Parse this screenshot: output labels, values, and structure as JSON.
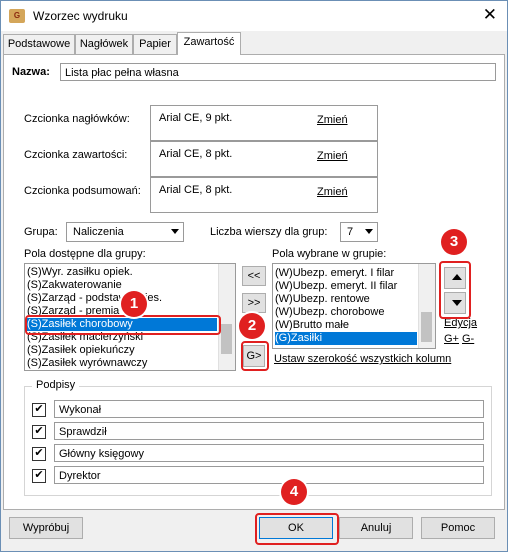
{
  "window": {
    "title": "Wzorzec wydruku",
    "app_icon": "G"
  },
  "tabs": [
    "Podstawowe",
    "Nagłówek",
    "Papier",
    "Zawartość"
  ],
  "name": {
    "label": "Nazwa:",
    "value": "Lista płac pełna własna"
  },
  "fonts": {
    "header": {
      "label": "Czcionka nagłówków:",
      "value": "Arial CE, 9 pkt.",
      "link": "Zmień"
    },
    "content": {
      "label": "Czcionka zawartości:",
      "value": "Arial CE, 8 pkt.",
      "link": "Zmień"
    },
    "summary": {
      "label": "Czcionka podsumowań:",
      "value": "Arial CE, 8 pkt.",
      "link": "Zmień"
    }
  },
  "group": {
    "label": "Grupa:",
    "value": "Naliczenia"
  },
  "rows": {
    "label": "Liczba wierszy dla grup:",
    "value": "7"
  },
  "available": {
    "label": "Pola dostępne dla grupy:",
    "items": [
      "(S)Wyr. zasiłku opiek.",
      "(S)Zakwaterowanie",
      "(S)Zarząd - podstawa mies.",
      "(S)Zarząd - premia 18%",
      "(S)Zasiłek chorobowy",
      "(S)Zasiłek macierzyński",
      "(S)Zasiłek opiekuńczy",
      "(S)Zasiłek wyrównawczy"
    ],
    "selected_index": 4
  },
  "transfer": {
    "all_left": "<<",
    "all_right": ">>",
    "group": "G>"
  },
  "chosen": {
    "label": "Pola wybrane w grupie:",
    "items": [
      "(W)Ubezp. emeryt. I filar",
      "(W)Ubezp. emeryt. II filar",
      "(W)Ubezp. rentowe",
      "(W)Ubezp. chorobowe",
      "(W)Brutto małe",
      "(G)Zasiłki"
    ],
    "selected_index": 5
  },
  "edit_link": "Edycja",
  "g_plus": "G+",
  "g_minus": "G-",
  "set_width_link": "Ustaw szerokość wszystkich kolumn",
  "signatures": {
    "label": "Podpisy",
    "items": [
      {
        "checked": true,
        "value": "Wykonał"
      },
      {
        "checked": true,
        "value": "Sprawdził"
      },
      {
        "checked": true,
        "value": "Główny księgowy"
      },
      {
        "checked": true,
        "value": "Dyrektor"
      }
    ]
  },
  "buttons": {
    "try": "Wypróbuj",
    "ok": "OK",
    "cancel": "Anuluj",
    "help": "Pomoc"
  },
  "badges": [
    "1",
    "2",
    "3",
    "4"
  ],
  "colors": {
    "highlight": "#e02020",
    "selection": "#0078d7"
  }
}
